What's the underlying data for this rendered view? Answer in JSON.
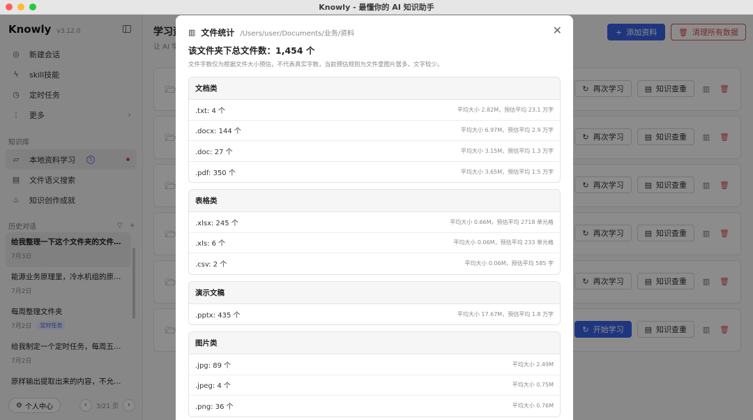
{
  "window": {
    "title": "Knowly - 最懂你的 AI 知识助手"
  },
  "sidebar": {
    "brand": "Knowly",
    "version": "v3.12.0",
    "nav": [
      {
        "label": "新建会话",
        "icon": "chat-icon"
      },
      {
        "label": "skill技能",
        "icon": "lightning-icon"
      },
      {
        "label": "定时任务",
        "icon": "clock-icon"
      },
      {
        "label": "更多",
        "icon": "more-icon"
      }
    ],
    "kb_label": "知识库",
    "kb_items": [
      {
        "label": "本地资料学习",
        "badge": "5",
        "icon": "folder-open-icon"
      },
      {
        "label": "文件语义搜索",
        "icon": "document-search-icon"
      },
      {
        "label": "知识创作成就",
        "icon": "flame-icon"
      }
    ],
    "history_label": "历史对话",
    "history": [
      {
        "title": "给我整理一下这个文件夹的文件，...",
        "date": "7月3日"
      },
      {
        "title": "能源业务原理里，冷水机组的原理...",
        "date": "7月2日"
      },
      {
        "title": "每周整理文件夹",
        "date": "7月2日",
        "tag": "定时任务"
      },
      {
        "title": "给我制定一个定时任务，每周五晚...",
        "date": "7月2日"
      },
      {
        "title": "原样输出提取出来的内容，不允许...",
        "date": ""
      }
    ],
    "profile_label": "个人中心",
    "pager": "3/21 页"
  },
  "main": {
    "title": "学习资",
    "subtitle": "让 AI 学",
    "add_label": "添加资料",
    "clear_label": "清理所有数据",
    "relearn_label": "再次学习",
    "start_label": "开始学习",
    "dedup_label": "知识查重"
  },
  "modal": {
    "title": "文件统计",
    "path": "/Users/user/Documents/业务/资料",
    "total": "该文件夹下总文件数：1,454 个",
    "note": "文件字数仅为根据文件大小预估，不代表真实字数，当前预估规则为文件里图片居多，文字较少。",
    "groups": [
      {
        "name": "文档类",
        "rows": [
          {
            "left": ".txt: 4 个",
            "right": "平均大小 2.82M，预估平均 23.1 万字"
          },
          {
            "left": ".docx: 144 个",
            "right": "平均大小 6.97M，预估平均 2.9 万字"
          },
          {
            "left": ".doc: 27 个",
            "right": "平均大小 3.15M，预估平均 1.3 万字"
          },
          {
            "left": ".pdf: 350 个",
            "right": "平均大小 3.65M，预估平均 1.5 万字"
          }
        ]
      },
      {
        "name": "表格类",
        "rows": [
          {
            "left": ".xlsx: 245 个",
            "right": "平均大小 0.66M，预估平均 2718 单元格"
          },
          {
            "left": ".xls: 6 个",
            "right": "平均大小 0.06M，预估平均 233 单元格"
          },
          {
            "left": ".csv: 2 个",
            "right": "平均大小 0.06M，预估平均 585 字"
          }
        ]
      },
      {
        "name": "演示文稿",
        "rows": [
          {
            "left": ".pptx: 435 个",
            "right": "平均大小 17.67M，预估平均 1.8 万字"
          }
        ]
      },
      {
        "name": "图片类",
        "rows": [
          {
            "left": ".jpg: 89 个",
            "right": "平均大小 2.49M"
          },
          {
            "left": ".jpeg: 4 个",
            "right": "平均大小 0.75M"
          },
          {
            "left": ".png: 36 个",
            "right": "平均大小 0.76M"
          }
        ]
      }
    ]
  }
}
